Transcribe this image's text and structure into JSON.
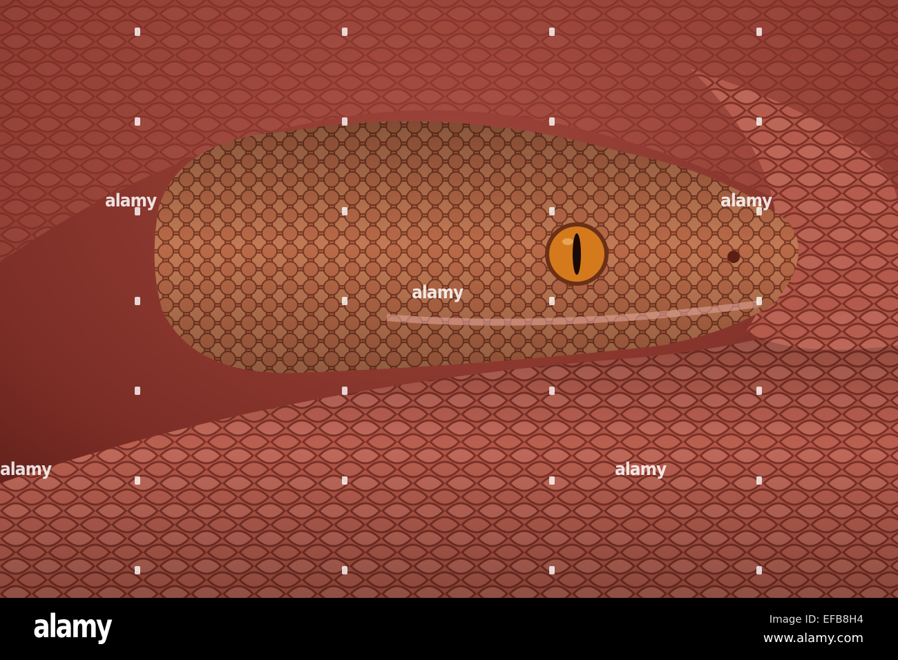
{
  "watermark": {
    "text": "alamy"
  },
  "footer": {
    "logo": "alamy",
    "image_id": "Image ID: EFB8H4",
    "url": "www.alamy.com"
  },
  "colors": {
    "background": "#7a2a22",
    "body": "#b25548",
    "head": "#a85a40",
    "eye": "#d07818"
  }
}
